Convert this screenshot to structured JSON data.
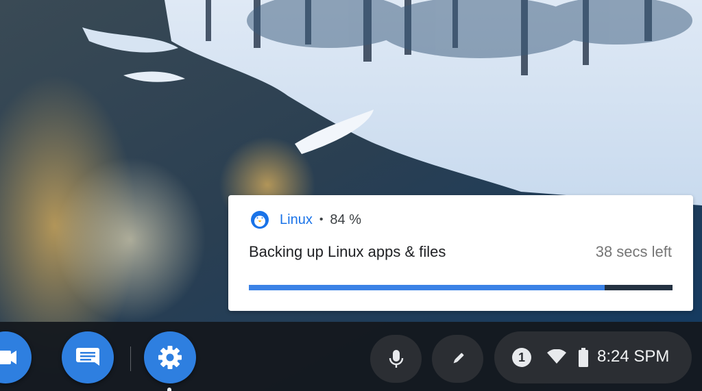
{
  "wallpaper": {
    "description_icon": "winter-river-wallpaper"
  },
  "notification": {
    "icon": "linux-penguin-icon",
    "source": "Linux",
    "separator": "•",
    "progress_text": "84 %",
    "progress": 0.84,
    "title": "Backing up Linux apps & files",
    "time_left": "38 secs left",
    "accent": "#1a73e8",
    "bar_color": "#3b82e6"
  },
  "shelf": {
    "apps": [
      {
        "name": "video-app",
        "icon": "video-camera-icon"
      },
      {
        "name": "messages-app",
        "icon": "message-icon"
      },
      {
        "name": "settings-app",
        "icon": "gear-icon",
        "running": true
      }
    ],
    "tray": {
      "mic_icon": "microphone-icon",
      "stylus_icon": "stylus-icon",
      "notification_count": "1",
      "wifi_icon": "wifi-icon",
      "battery_icon": "battery-icon",
      "time": "8:24 SPM"
    }
  }
}
